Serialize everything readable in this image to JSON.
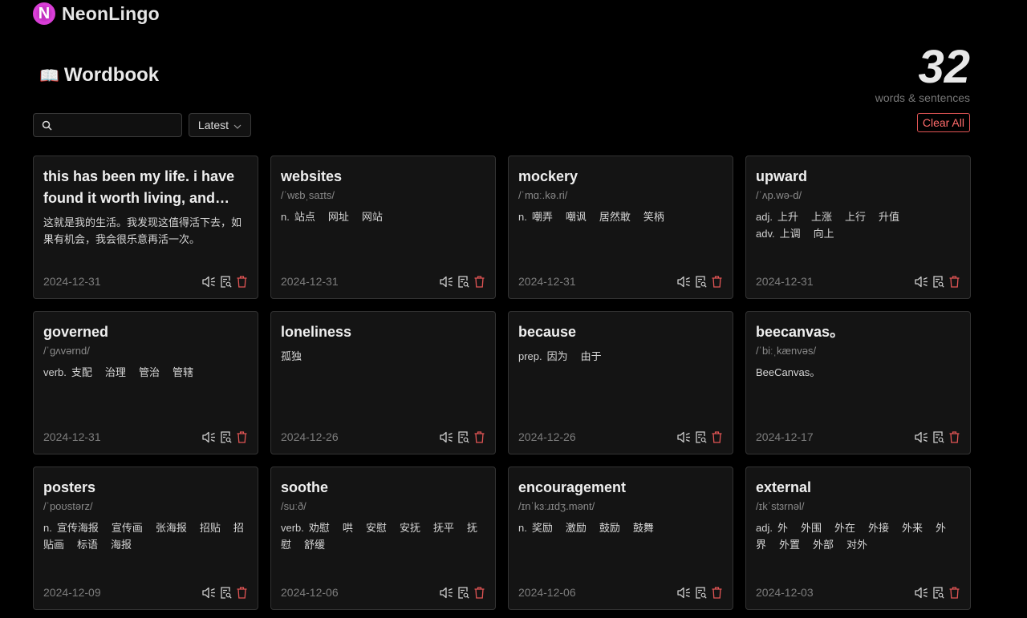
{
  "app": {
    "name": "NeonLingo",
    "logo_letter": "N"
  },
  "page": {
    "title": "Wordbook",
    "title_icon": "📖"
  },
  "stats": {
    "count": "32",
    "label": "words & sentences"
  },
  "toolbar": {
    "search_placeholder": "",
    "sort_selected": "Latest",
    "clear_label": "Clear All"
  },
  "colors": {
    "accent": "#c233c0",
    "danger": "#e25555",
    "card_bg": "#141414"
  },
  "cards": [
    {
      "word": "this has been my life. i have found it worth living, and wou...",
      "phonetic": "",
      "lines": [
        {
          "pos": "",
          "meanings": [
            "这就是我的生活。我发现这值得活下去，如果有机会，我会很乐意再活一次。"
          ]
        }
      ],
      "date": "2024-12-31"
    },
    {
      "word": "websites",
      "phonetic": "/ˈwɛbˌsaɪts/",
      "lines": [
        {
          "pos": "n.",
          "meanings": [
            "站点",
            "网址",
            "网站"
          ]
        }
      ],
      "date": "2024-12-31"
    },
    {
      "word": "mockery",
      "phonetic": "/ˈmɑː.kə.ri/",
      "lines": [
        {
          "pos": "n.",
          "meanings": [
            "嘲弄",
            "嘲讽",
            "居然敢",
            "笑柄"
          ]
        }
      ],
      "date": "2024-12-31"
    },
    {
      "word": "upward",
      "phonetic": "/ˈʌp.wə-d/",
      "lines": [
        {
          "pos": "adj.",
          "meanings": [
            "上升",
            "上涨",
            "上行",
            "升值"
          ]
        },
        {
          "pos": "adv.",
          "meanings": [
            "上调",
            "向上"
          ]
        }
      ],
      "date": "2024-12-31"
    },
    {
      "word": "governed",
      "phonetic": "/ˈɡʌvərnd/",
      "lines": [
        {
          "pos": "verb.",
          "meanings": [
            "支配",
            "治理",
            "管治",
            "管辖"
          ]
        }
      ],
      "date": "2024-12-31"
    },
    {
      "word": "loneliness",
      "phonetic": "",
      "lines": [
        {
          "pos": "",
          "meanings": [
            "孤独"
          ]
        }
      ],
      "date": "2024-12-26"
    },
    {
      "word": "because",
      "phonetic": "",
      "lines": [
        {
          "pos": "prep.",
          "meanings": [
            "因为",
            "由于"
          ]
        }
      ],
      "date": "2024-12-26"
    },
    {
      "word": "beecanvas。",
      "phonetic": "/ˈbiːˌkænvəs/",
      "lines": [
        {
          "pos": "",
          "meanings": [
            "BeeCanvas。"
          ]
        }
      ],
      "date": "2024-12-17"
    },
    {
      "word": "posters",
      "phonetic": "/ˈpoʊstərz/",
      "lines": [
        {
          "pos": "n.",
          "meanings": [
            "宣传海报",
            "宣传画",
            "张海报",
            "招贴",
            "招贴画",
            "标语",
            "海报"
          ]
        }
      ],
      "date": "2024-12-09"
    },
    {
      "word": "soothe",
      "phonetic": "/suːð/",
      "lines": [
        {
          "pos": "verb.",
          "meanings": [
            "劝慰",
            "哄",
            "安慰",
            "安抚",
            "抚平",
            "抚慰",
            "舒缓"
          ]
        }
      ],
      "date": "2024-12-06"
    },
    {
      "word": "encouragement",
      "phonetic": "/ɪnˈkɜːɹɪdʒ.mənt/",
      "lines": [
        {
          "pos": "n.",
          "meanings": [
            "奖励",
            "激励",
            "鼓励",
            "鼓舞"
          ]
        }
      ],
      "date": "2024-12-06"
    },
    {
      "word": "external",
      "phonetic": "/ɪkˈstɜrnəl/",
      "lines": [
        {
          "pos": "adj.",
          "meanings": [
            "外",
            "外围",
            "外在",
            "外接",
            "外来",
            "外界",
            "外置",
            "外部",
            "对外"
          ]
        }
      ],
      "date": "2024-12-03"
    }
  ]
}
